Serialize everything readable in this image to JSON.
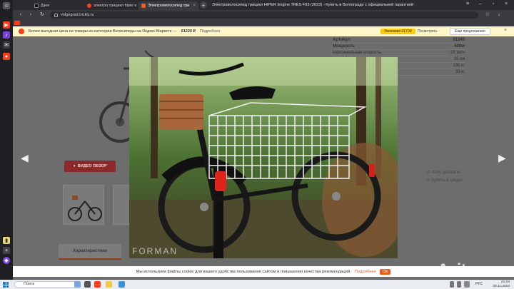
{
  "browser": {
    "tabs": [
      {
        "label": "Дзен",
        "favicon_color": "#222222"
      },
      {
        "label": "электро трицикл hiper e",
        "favicon_color": "#fc3f1d"
      },
      {
        "label": "Электровелосипед три",
        "favicon_color": "#e35f1c"
      }
    ],
    "page_title": "Электровелосипед трицикл HIPER Engine TRES F03 (2023) - Купить в Волгограде с официальной гарантией",
    "url": "volgograd.trickly.ru"
  },
  "promo": {
    "text": "Более выгодная цена на товары из категории Велосипеды на Яндекс.Маркете —",
    "price": "61220 ₽",
    "more": "Подробнее",
    "bonus": "Экономия 3170₽",
    "watch": "Посмотреть",
    "offers": "Еще предложения"
  },
  "specs": [
    {
      "key": "Артикул",
      "value": "01340"
    },
    {
      "key": "Мощность",
      "value": "500w"
    },
    {
      "key": "Максимальная скорость",
      "value": "25 км/ч"
    },
    {
      "key": "",
      "value": "35 км"
    },
    {
      "key": "",
      "value": "130 кг"
    },
    {
      "key": "",
      "value": "33 кг"
    }
  ],
  "video_button": "ВИДЕО ОБЗОР",
  "want_cheaper": "Хочу дешевле",
  "buy_credit": "Купить в кредит",
  "characteristics_tab": "Характеристики",
  "watermark_text": "FORMAN",
  "cookie": {
    "text": "Мы используем файлы cookie для вашего удобства пользования сайтом и повышения качества рекомендаций.",
    "more": "Подробнее",
    "ok": "Ok"
  },
  "taskbar": {
    "search_placeholder": "Поиск",
    "lang": "РУС",
    "time": "21:03",
    "date": "28.11.2023"
  },
  "avito_watermark": "Avito"
}
